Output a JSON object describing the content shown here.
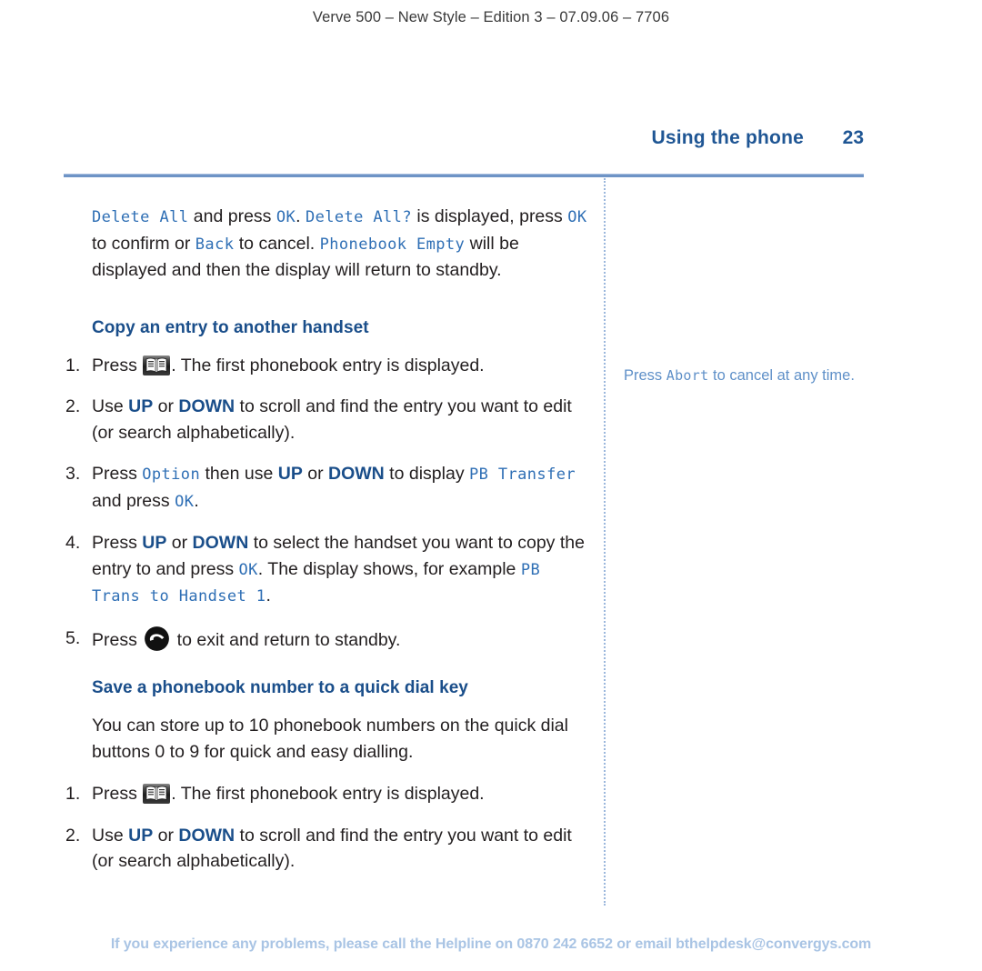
{
  "document": {
    "running_header": "Verve 500 – New Style – Edition 3 – 07.09.06 – 7706",
    "page_title": "Using the phone",
    "page_number": "23",
    "footer": "If you experience any problems, please call the Helpline on 0870 242 6652 or email bthelpdesk@convergys.com"
  },
  "colors": {
    "heading_blue": "#1a4e8a",
    "title_blue": "#1f5694",
    "lcd_blue": "#2f6fb5",
    "note_blue": "#5f90c8",
    "footer_blue": "#a9c4e4",
    "rule_blue": "#6e94c6",
    "body_text": "#231f20"
  },
  "continued_paragraph": {
    "s1_lcd": "Delete All",
    "s2": " and press ",
    "s3_lcd": "OK",
    "s4": ". ",
    "s5_lcd": "Delete All?",
    "s6": " is displayed, press ",
    "s7_lcd": "OK",
    "s8": " to confirm or ",
    "s9_lcd": "Back",
    "s10": " to cancel. ",
    "s11_lcd": "Phonebook Empty",
    "s12": " will be displayed and then the display will return to standby."
  },
  "section_copy_entry": {
    "heading": "Copy an entry to another handset",
    "steps": [
      {
        "num": "1.",
        "pre": "Press ",
        "icon": "phonebook-icon",
        "post": ". The first phonebook entry is displayed."
      },
      {
        "num": "2.",
        "a": "Use ",
        "key1": "UP",
        "b": " or ",
        "key2": "DOWN",
        "c": " to scroll and find the entry you want to edit (or search alphabetically)."
      },
      {
        "num": "3.",
        "a": "Press ",
        "lcd1": "Option",
        "b": " then use ",
        "key1": "UP",
        "c": " or ",
        "key2": "DOWN",
        "d": " to display ",
        "lcd2": "PB Transfer",
        "e": " and press ",
        "lcd3": "OK",
        "f": "."
      },
      {
        "num": "4.",
        "a": "Press ",
        "key1": "UP",
        "b": " or ",
        "key2": "DOWN",
        "c": " to select the handset you want to copy the entry to and press ",
        "lcd1": "OK",
        "d": ". The display shows, for example ",
        "lcd2": "PB Trans to Handset 1",
        "e": "."
      },
      {
        "num": "5.",
        "pre": "Press ",
        "icon": "end-call-icon",
        "post": " to exit and return to standby."
      }
    ]
  },
  "section_quick_dial": {
    "heading": "Save a phonebook number to a quick dial key",
    "intro": "You can store up to 10 phonebook numbers on the quick dial buttons 0 to 9 for quick and easy dialling.",
    "steps": [
      {
        "num": "1.",
        "pre": "Press ",
        "icon": "phonebook-icon",
        "post": ". The first phonebook entry is displayed."
      },
      {
        "num": "2.",
        "a": "Use ",
        "key1": "UP",
        "b": " or ",
        "key2": "DOWN",
        "c": " to scroll and find the entry you want to edit (or search alphabetically)."
      }
    ]
  },
  "margin_note": {
    "pre": "Press ",
    "lcd": "Abort",
    "post": " to cancel at any time."
  }
}
